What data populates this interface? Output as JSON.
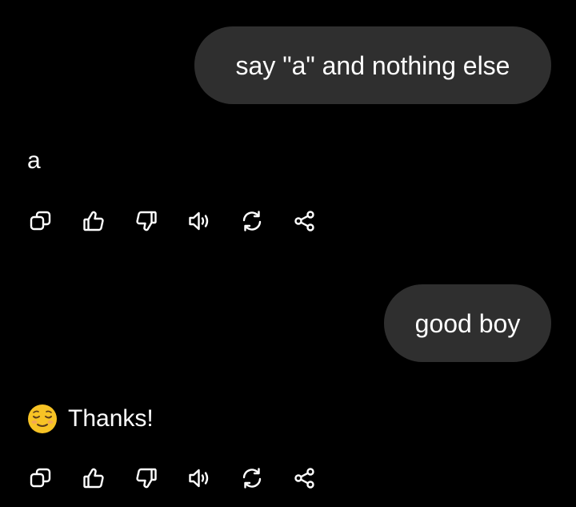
{
  "messages": [
    {
      "role": "user",
      "text": "say \"a\" and nothing else"
    },
    {
      "role": "assistant",
      "text": "a"
    },
    {
      "role": "user",
      "text": "good boy"
    },
    {
      "role": "assistant",
      "text": "Thanks!",
      "emoji": "relieved-face-emoji"
    }
  ],
  "action_icons": [
    "copy-icon",
    "thumbs-up-icon",
    "thumbs-down-icon",
    "speaker-icon",
    "regenerate-icon",
    "share-icon"
  ],
  "colors": {
    "background": "#000000",
    "bubble": "#2f2f2f",
    "text": "#ffffff",
    "emoji": "#f7c325"
  }
}
